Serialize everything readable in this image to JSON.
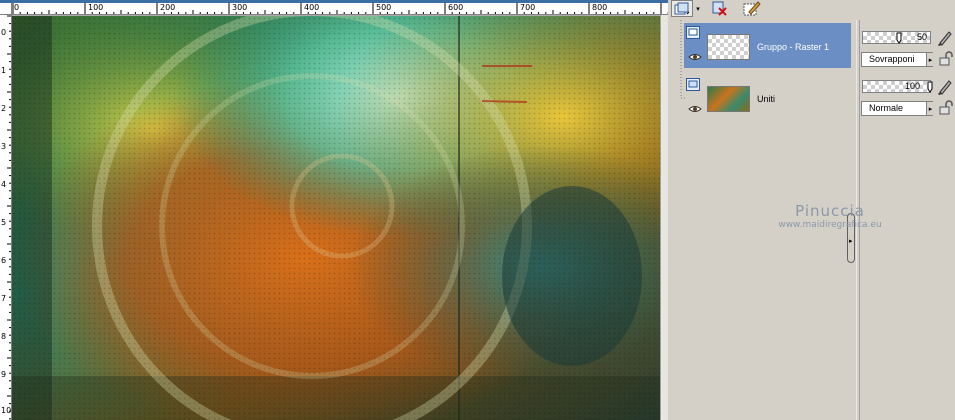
{
  "ruler": {
    "top_labels": [
      "0",
      "100",
      "200",
      "300",
      "400",
      "500",
      "600",
      "700",
      "800"
    ],
    "left_labels": [
      "0",
      "1",
      "2",
      "3",
      "4",
      "5",
      "6",
      "7",
      "8",
      "9",
      "10"
    ]
  },
  "toolbar": {
    "icons": [
      "new-layer-icon",
      "delete-layer-icon",
      "edit-icon"
    ]
  },
  "layers": [
    {
      "name": "Gruppo - Raster 1",
      "selected": true,
      "thumb": "transparent",
      "opacity": "50",
      "blend_mode": "Sovrapponi"
    },
    {
      "name": "Uniti",
      "selected": false,
      "thumb": "image",
      "opacity": "100",
      "blend_mode": "Normale"
    }
  ],
  "watermark": {
    "name": "Pinuccia",
    "url": "www.maidiregrafica.eu"
  },
  "colors": {
    "selection": "#6b8fc4",
    "panel_bg": "#d4d0c8",
    "watermark": "#8c98a8"
  }
}
